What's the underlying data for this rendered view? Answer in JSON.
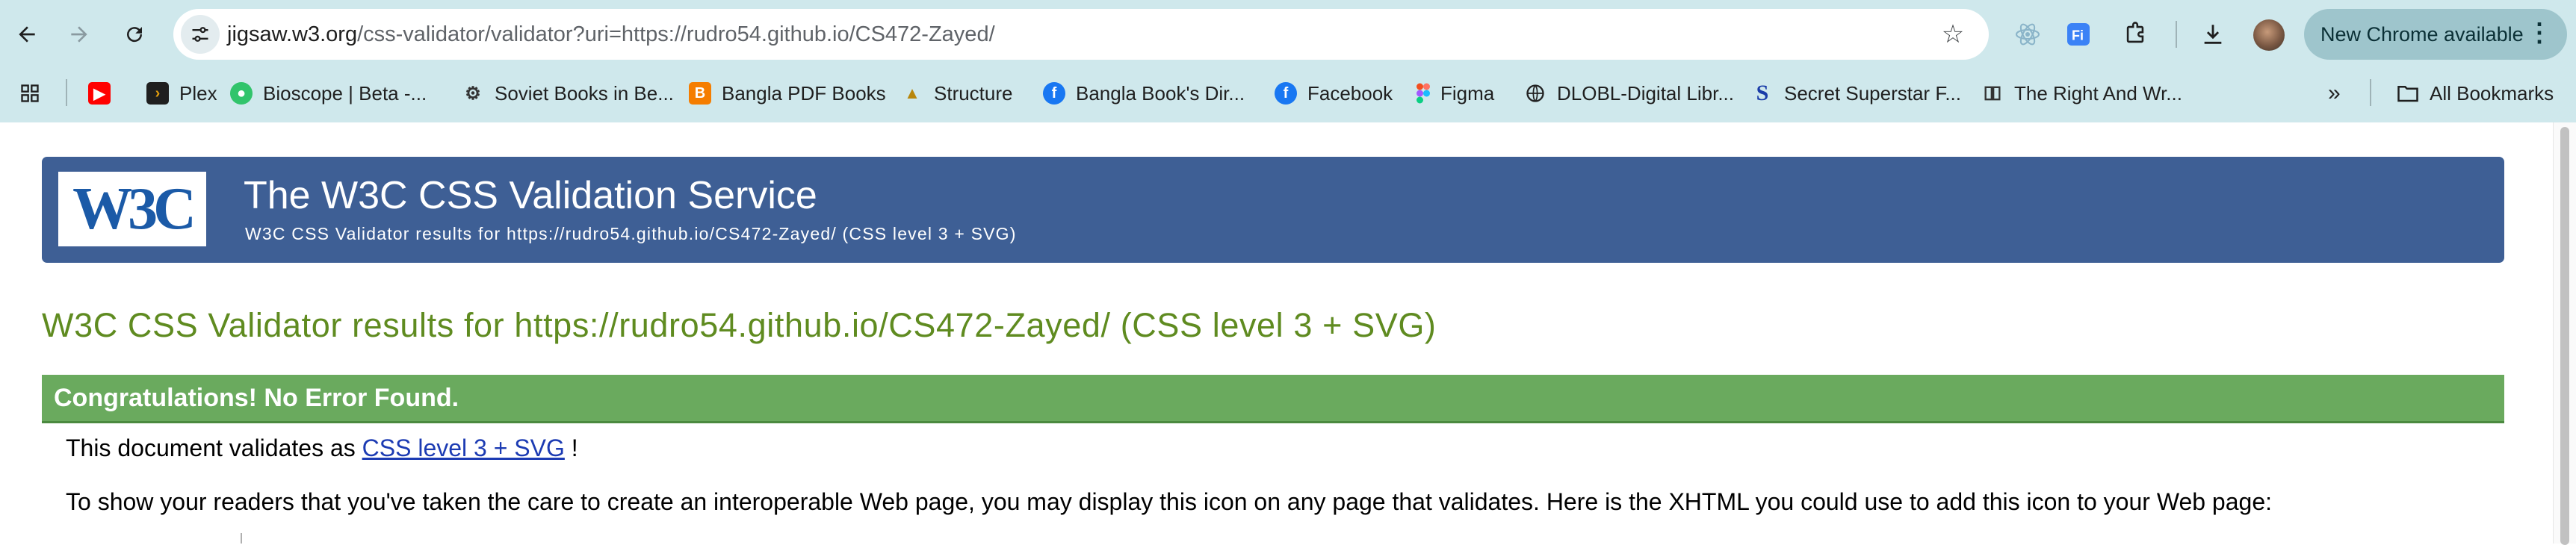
{
  "browser": {
    "url_host": "jigsaw.w3.org",
    "url_path": "/css-validator/validator?uri=https://rudro54.github.io/CS472-Zayed/",
    "update_button_label": "New Chrome available",
    "bookmarks": [
      {
        "label": "",
        "icon": "youtube-icon",
        "color": "#ff0000"
      },
      {
        "label": "Plex",
        "icon": "plex-icon",
        "color": "#e5a00d"
      },
      {
        "label": "Bioscope | Beta -...",
        "icon": "bioscope-icon",
        "color": "#31c46b"
      },
      {
        "label": "Soviet Books in Be...",
        "icon": "soviet-books-icon",
        "color": "#333333"
      },
      {
        "label": "Bangla PDF Books",
        "icon": "blogger-icon",
        "color": "#f57d00"
      },
      {
        "label": "Structure",
        "icon": "structure-icon",
        "color": "#b8860b"
      },
      {
        "label": "Bangla Book's Dir...",
        "icon": "facebook-icon",
        "color": "#1877f2"
      },
      {
        "label": "Facebook",
        "icon": "facebook-icon",
        "color": "#1877f2"
      },
      {
        "label": "Figma",
        "icon": "figma-icon",
        "color": "#f24e1e"
      },
      {
        "label": "DLOBL-Digital Libr...",
        "icon": "globe-icon",
        "color": "#222222"
      },
      {
        "label": "Secret Superstar F...",
        "icon": "s-icon",
        "color": "#1a3ca8"
      },
      {
        "label": "The Right And Wr...",
        "icon": "book-icon",
        "color": "#333333"
      }
    ],
    "all_bookmarks_label": "All Bookmarks"
  },
  "page": {
    "logo_text": "W3C",
    "banner_title": "The W3C CSS Validation Service",
    "banner_subtitle": "W3C CSS Validator results for https://rudro54.github.io/CS472-Zayed/ (CSS level 3 + SVG)",
    "results_title": "W3C CSS Validator results for https://rudro54.github.io/CS472-Zayed/ (CSS level 3 + SVG)",
    "congrats": "Congratulations! No Error Found.",
    "validates_prefix": "This document validates as",
    "validates_link": "CSS level 3 + SVG",
    "validates_suffix": "!",
    "paragraph": "To show your readers that you've taken the care to create an interoperable Web page, you may display this icon on any page that validates. Here is the XHTML you could use to add this icon to your Web page:"
  },
  "colors": {
    "chrome_bg": "#cfe8ec",
    "banner_bg": "#3e5f95",
    "title_green": "#5f8b20",
    "congrats_bg": "#6aaa5e",
    "link": "#1c3bb3"
  }
}
